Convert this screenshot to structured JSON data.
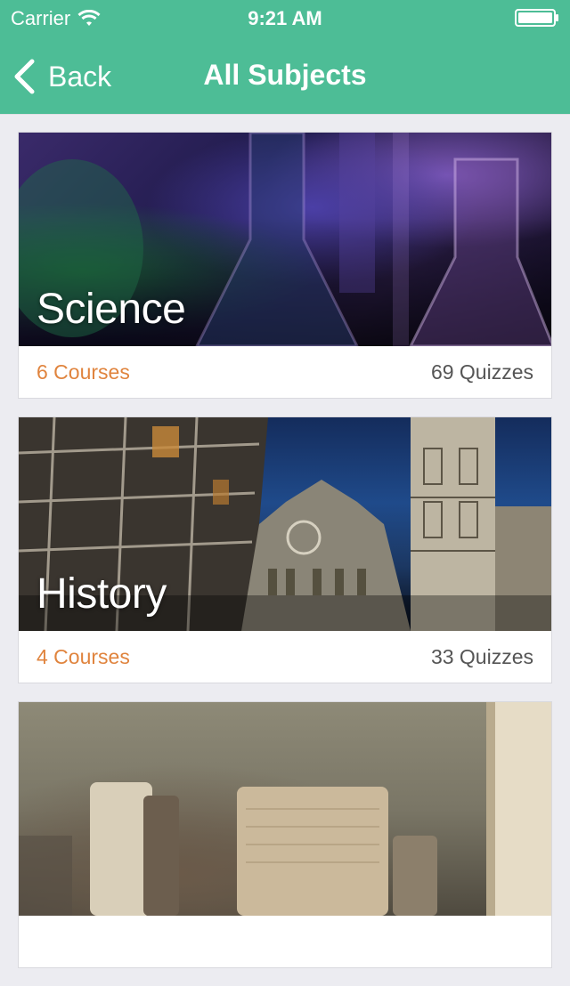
{
  "status_bar": {
    "carrier": "Carrier",
    "time": "9:21 AM"
  },
  "nav": {
    "back_label": "Back",
    "title": "All Subjects"
  },
  "subjects": [
    {
      "title": "Science",
      "courses": "6 Courses",
      "quizzes": "69 Quizzes"
    },
    {
      "title": "History",
      "courses": "4 Courses",
      "quizzes": "33 Quizzes"
    }
  ],
  "colors": {
    "nav_bg": "#4dbd96",
    "courses_accent": "#e0843e",
    "background": "#ececf1"
  }
}
